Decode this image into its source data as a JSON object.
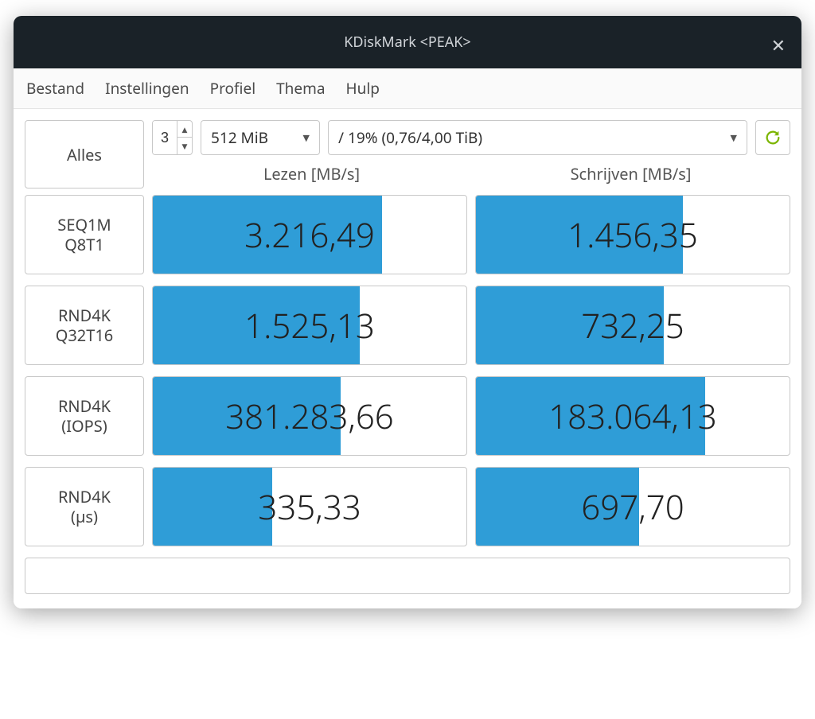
{
  "title": "KDiskMark <PEAK>",
  "menu": {
    "file": "Bestand",
    "settings": "Instellingen",
    "profile": "Profiel",
    "theme": "Thema",
    "help": "Hulp"
  },
  "controls": {
    "all_button": "Alles",
    "loops": "3",
    "size": "512 MiB",
    "drive": "/ 19% (0,76/4,00 TiB)"
  },
  "columns": {
    "read": "Lezen [MB/s]",
    "write": "Schrijven [MB/s]"
  },
  "rows": [
    {
      "label1": "SEQ1M",
      "label2": "Q8T1",
      "read": {
        "value": "3.216,49",
        "fill": 73
      },
      "write": {
        "value": "1.456,35",
        "fill": 66
      }
    },
    {
      "label1": "RND4K",
      "label2": "Q32T16",
      "read": {
        "value": "1.525,13",
        "fill": 66
      },
      "write": {
        "value": "732,25",
        "fill": 60
      }
    },
    {
      "label1": "RND4K",
      "label2": "(IOPS)",
      "read": {
        "value": "381.283,66",
        "fill": 60
      },
      "write": {
        "value": "183.064,13",
        "fill": 73
      }
    },
    {
      "label1": "RND4K",
      "label2": "(µs)",
      "read": {
        "value": "335,33",
        "fill": 38
      },
      "write": {
        "value": "697,70",
        "fill": 52
      }
    }
  ],
  "status": "",
  "colors": {
    "bar": "#2f9dd7",
    "refresh": "#7cb500"
  }
}
